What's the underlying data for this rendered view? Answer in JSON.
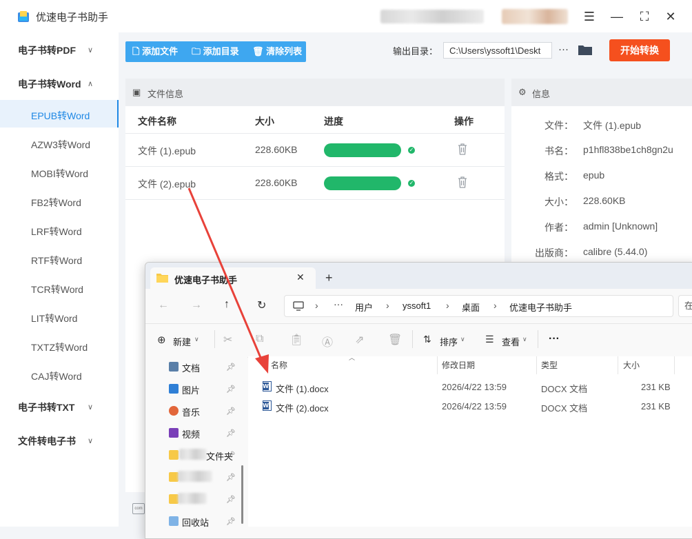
{
  "app": {
    "title": "优速电子书助手",
    "window_buttons": [
      "☰",
      "—",
      "⛶",
      "✕"
    ]
  },
  "sidebar": {
    "groups": [
      {
        "label": "电子书转PDF",
        "chevron": "∨"
      },
      {
        "label": "电子书转Word",
        "chevron": "∧"
      },
      {
        "label": "电子书转TXT",
        "chevron": "∨"
      },
      {
        "label": "文件转电子书",
        "chevron": "∨"
      }
    ],
    "items": [
      "EPUB转Word",
      "AZW3转Word",
      "MOBI转Word",
      "FB2转Word",
      "LRF转Word",
      "RTF转Word",
      "TCR转Word",
      "LIT转Word",
      "TXTZ转Word",
      "CAJ转Word"
    ],
    "active_item": "EPUB转Word"
  },
  "toolbar": {
    "add_file": "添加文件",
    "add_dir": "添加目录",
    "clear_list": "清除列表",
    "output_label": "输出目录：",
    "output_path": "C:\\Users\\yssoft1\\Deskt",
    "more": "···",
    "start": "开始转换"
  },
  "file_panel": {
    "title": "文件信息",
    "columns": [
      "文件名称",
      "大小",
      "进度",
      "操作"
    ],
    "rows": [
      {
        "name": "文件 (1).epub",
        "size": "228.60KB",
        "progress": 1.0
      },
      {
        "name": "文件 (2).epub",
        "size": "228.60KB",
        "progress": 1.0
      }
    ]
  },
  "info_panel": {
    "title": "信息",
    "fields": [
      {
        "label": "文件：",
        "value": "文件 (1).epub"
      },
      {
        "label": "书名：",
        "value": "p1hfl838be1ch8gn2u"
      },
      {
        "label": "格式：",
        "value": "epub"
      },
      {
        "label": "大小：",
        "value": "228.60KB"
      },
      {
        "label": "作者：",
        "value": "admin [Unknown]"
      },
      {
        "label": "出版商：",
        "value": "calibre (5.44.0)"
      }
    ]
  },
  "explorer": {
    "tab_title": "优速电子书助手",
    "breadcrumb": [
      "用户",
      "yssoft1",
      "桌面",
      "优速电子书助手"
    ],
    "search_placeholder": "在",
    "commands": {
      "new": "新建",
      "sort": "排序",
      "view": "查看",
      "more": "···"
    },
    "nav_items": [
      "文档",
      "图片",
      "音乐",
      "视频",
      "文件夹",
      "",
      "",
      "回收站"
    ],
    "columns": [
      "名称",
      "修改日期",
      "类型",
      "大小"
    ],
    "files": [
      {
        "name": "文件 (1).docx",
        "modified": "2026/4/22 13:59",
        "type": "DOCX 文档",
        "size": "231 KB"
      },
      {
        "name": "文件 (2).docx",
        "modified": "2026/4/22 13:59",
        "type": "DOCX 文档",
        "size": "231 KB"
      }
    ]
  },
  "colors": {
    "accent": "#3ea7f0",
    "start": "#f5501e",
    "progress": "#21b76a",
    "annotation_arrow": "#e8423a"
  }
}
